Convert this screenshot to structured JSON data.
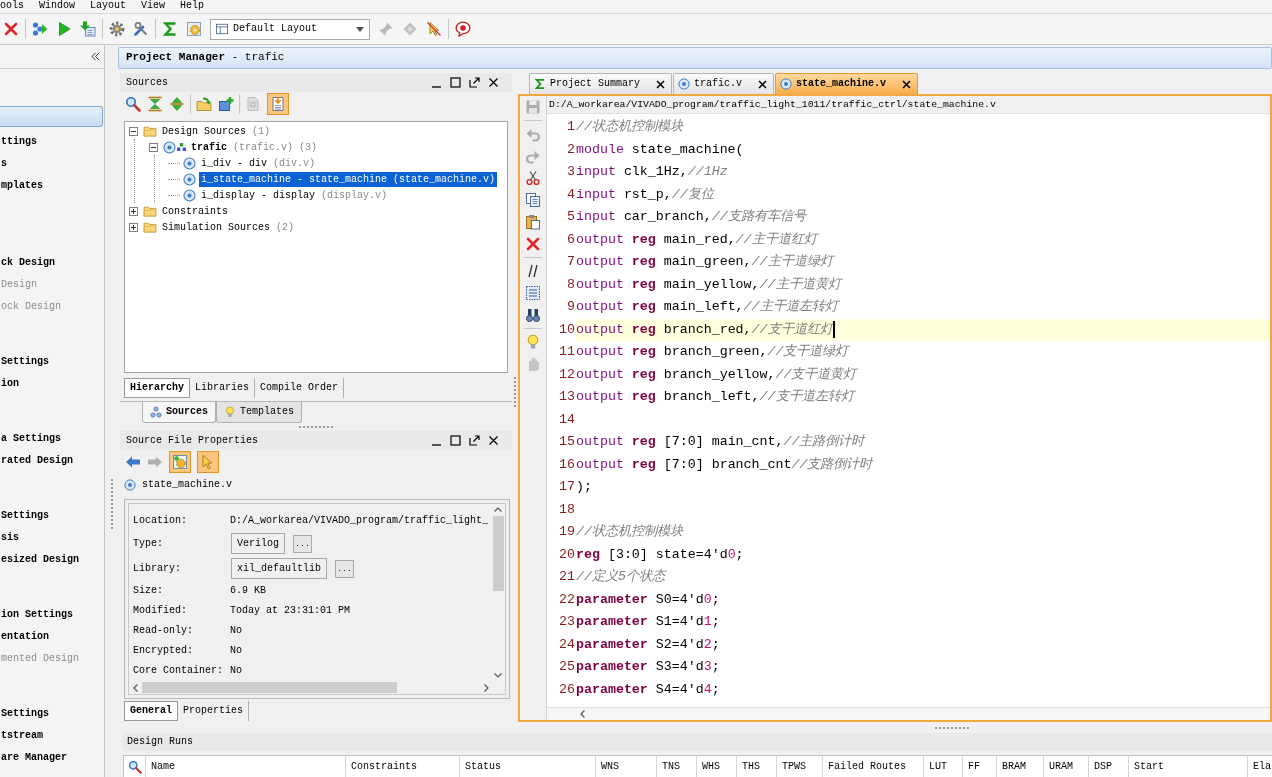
{
  "menu_bar": {
    "items": [
      "ools",
      "Window",
      "Layout",
      "View",
      "Help"
    ]
  },
  "toolbar": {
    "groups": [
      {
        "items": [
          {
            "kind": "cancel",
            "disabled": false
          }
        ]
      },
      {
        "items": [
          {
            "kind": "run",
            "disabled": false
          },
          {
            "kind": "play",
            "disabled": false
          },
          {
            "kind": "program",
            "disabled": false
          }
        ]
      },
      {
        "items": [
          {
            "kind": "settings",
            "disabled": false
          },
          {
            "kind": "tools",
            "disabled": false
          }
        ]
      },
      {
        "items": [
          {
            "kind": "sigma",
            "disabled": false
          },
          {
            "kind": "report",
            "disabled": false
          },
          {
            "kind": "layout_select",
            "value": "Default Layout",
            "disabled": false
          },
          {
            "kind": "pin",
            "disabled": true
          },
          {
            "kind": "diamond",
            "disabled": true
          },
          {
            "kind": "pointer",
            "disabled": false
          }
        ]
      },
      {
        "items": [
          {
            "kind": "bubble",
            "disabled": false
          }
        ]
      }
    ]
  },
  "flow_navigator": {
    "sections": [
      {
        "selected": true,
        "items": [
          {
            "label": "ttings",
            "disabled": false
          },
          {
            "label": "s",
            "disabled": false
          },
          {
            "label": "mplates",
            "disabled": false
          }
        ]
      },
      {
        "selected": false,
        "items": [
          {
            "label": "ck Design",
            "disabled": false
          },
          {
            "label": "Design",
            "disabled": true
          },
          {
            "label": "ock Design",
            "disabled": true
          }
        ]
      },
      {
        "selected": false,
        "items": [
          {
            "label": "Settings",
            "disabled": false
          },
          {
            "label": "ion",
            "disabled": false
          }
        ]
      },
      {
        "selected": false,
        "items": [
          {
            "label": "a Settings",
            "disabled": false
          },
          {
            "label": "rated Design",
            "disabled": false
          }
        ]
      },
      {
        "selected": false,
        "items": [
          {
            "label": "Settings",
            "disabled": false
          },
          {
            "label": "sis",
            "disabled": false
          },
          {
            "label": "esized Design",
            "disabled": false
          }
        ]
      },
      {
        "selected": false,
        "items": [
          {
            "label": "ion Settings",
            "disabled": false
          },
          {
            "label": "entation",
            "disabled": false
          },
          {
            "label": "mented Design",
            "disabled": true
          }
        ]
      },
      {
        "selected": false,
        "items": [
          {
            "label": "Settings",
            "disabled": false
          },
          {
            "label": "tstream",
            "disabled": false
          },
          {
            "label": "are Manager",
            "disabled": false
          }
        ]
      }
    ]
  },
  "project_manager": {
    "title": "**Project Manager** - trafic"
  },
  "sources_panel": {
    "title": "Sources",
    "toolbar": {
      "groups": [
        {
          "items": [
            {
              "kind": "search",
              "disabled": false,
              "on": false
            },
            {
              "kind": "collapse_all",
              "disabled": false,
              "on": false
            },
            {
              "kind": "expand_all",
              "disabled": false,
              "on": false
            }
          ]
        },
        {
          "items": [
            {
              "kind": "add_folder",
              "disabled": false,
              "on": false
            },
            {
              "kind": "add_sources",
              "disabled": false,
              "on": false
            }
          ]
        },
        {
          "items": [
            {
              "kind": "help_doc",
              "disabled": true,
              "on": false
            },
            {
              "kind": "autoupdate",
              "disabled": false,
              "on": true
            }
          ]
        }
      ]
    },
    "tree": [
      {
        "kind": "folder",
        "label": "Design Sources",
        "count": "(1)",
        "expanded": true,
        "selected": false,
        "children": [
          {
            "kind": "top",
            "label": "trafic",
            "file": "(trafic.v)",
            "count": "(3)",
            "expanded": true,
            "selected": false,
            "children": [
              {
                "kind": "module",
                "label": "i_div - div",
                "file": "(div.v)",
                "selected": false
              },
              {
                "kind": "module",
                "label": "i_state_machine - state_machine",
                "file": "(state_machine.v)",
                "selected": true
              },
              {
                "kind": "module",
                "label": "i_display - display",
                "file": "(display.v)",
                "selected": false
              }
            ]
          }
        ]
      },
      {
        "kind": "folder",
        "label": "Constraints",
        "expanded": false,
        "selected": false
      },
      {
        "kind": "folder",
        "label": "Simulation Sources",
        "count": "(2)",
        "expanded": false,
        "selected": false
      }
    ],
    "view_tabs": [
      {
        "label": "Hierarchy",
        "selected": true
      },
      {
        "label": "Libraries",
        "selected": false
      },
      {
        "label": "Compile Order",
        "selected": false
      }
    ],
    "bottom_tabs": [
      {
        "kind": "sources",
        "label": "Sources",
        "selected": true
      },
      {
        "kind": "templates",
        "label": "Templates",
        "selected": false
      }
    ]
  },
  "properties_panel": {
    "title": "Source File Properties",
    "toolbar": {
      "groups": [
        {
          "items": [
            {
              "kind": "back",
              "disabled": false,
              "on": false
            },
            {
              "kind": "forward",
              "disabled": true,
              "on": false
            },
            {
              "kind": "gear_doc",
              "disabled": false,
              "on": true
            },
            {
              "kind": "select_pointer",
              "disabled": false,
              "on": true
            }
          ]
        }
      ]
    },
    "file": "state_machine.v",
    "rows": [
      {
        "kind": "text",
        "label": "Location:",
        "value": "D:/A_workarea/VIVADO_program/traffic_light_"
      },
      {
        "kind": "field",
        "label": "Type:",
        "value": "Verilog",
        "button": "..."
      },
      {
        "kind": "field",
        "label": "Library:",
        "value": "xil_defaultlib",
        "button": "..."
      },
      {
        "kind": "text",
        "label": "Size:",
        "value": "6.9 KB"
      },
      {
        "kind": "text",
        "label": "Modified:",
        "value": "Today at 23:31:01 PM"
      },
      {
        "kind": "text",
        "label": "Read-only:",
        "value": "No"
      },
      {
        "kind": "text",
        "label": "Encrypted:",
        "value": "No"
      },
      {
        "kind": "text",
        "label": "Core Container:",
        "value": "No"
      }
    ],
    "tabs": [
      {
        "label": "General",
        "selected": true
      },
      {
        "label": "Properties",
        "selected": false
      }
    ]
  },
  "editor": {
    "tabs": [
      {
        "kind": "summary",
        "label": "Project Summary",
        "selected": false
      },
      {
        "kind": "verilog",
        "label": "trafic.v",
        "selected": false
      },
      {
        "kind": "verilog",
        "label": "state_machine.v",
        "selected": true
      }
    ],
    "path": "D:/A_workarea/VIVADO_program/traffic_light_1011/traffic_ctrl/state_machine.v",
    "gutter_toolbar": {
      "groups": [
        {
          "items": [
            {
              "kind": "save",
              "disabled": true
            }
          ]
        },
        {
          "items": [
            {
              "kind": "undo",
              "disabled": true
            },
            {
              "kind": "redo",
              "disabled": true
            },
            {
              "kind": "cut",
              "disabled": false
            },
            {
              "kind": "copy",
              "disabled": false
            },
            {
              "kind": "paste",
              "disabled": false
            },
            {
              "kind": "delete",
              "disabled": false
            }
          ]
        },
        {
          "items": [
            {
              "kind": "comment",
              "disabled": false
            },
            {
              "kind": "block",
              "disabled": false
            },
            {
              "kind": "find",
              "disabled": false
            }
          ]
        },
        {
          "items": [
            {
              "kind": "bulb",
              "disabled": false
            },
            {
              "kind": "hand",
              "disabled": true
            }
          ]
        }
      ]
    },
    "lines": [
      {
        "number": "1",
        "current": false,
        "tokens": [
          {
            "kind": "comment",
            "text": "//状态机控制模块"
          }
        ]
      },
      {
        "number": "2",
        "current": false,
        "tokens": [
          {
            "kind": "keyword",
            "text": "module"
          },
          {
            "kind": "plain",
            "text": " state_machine("
          }
        ]
      },
      {
        "number": "3",
        "current": false,
        "tokens": [
          {
            "kind": "keyword",
            "text": "input"
          },
          {
            "kind": "plain",
            "text": " clk_1Hz,"
          },
          {
            "kind": "comment",
            "text": "//1Hz"
          }
        ]
      },
      {
        "number": "4",
        "current": false,
        "tokens": [
          {
            "kind": "keyword",
            "text": "input"
          },
          {
            "kind": "plain",
            "text": " rst_p,"
          },
          {
            "kind": "comment",
            "text": "//复位"
          }
        ]
      },
      {
        "number": "5",
        "current": false,
        "tokens": [
          {
            "kind": "keyword",
            "text": "input"
          },
          {
            "kind": "plain",
            "text": " car_branch,"
          },
          {
            "kind": "comment",
            "text": "//支路有车信号"
          }
        ]
      },
      {
        "number": "6",
        "current": false,
        "tokens": [
          {
            "kind": "keyword",
            "text": "output "
          },
          {
            "kind": "type",
            "text": "reg"
          },
          {
            "kind": "plain",
            "text": " main_red,"
          },
          {
            "kind": "comment",
            "text": "//主干道红灯"
          }
        ]
      },
      {
        "number": "7",
        "current": false,
        "tokens": [
          {
            "kind": "keyword",
            "text": "output "
          },
          {
            "kind": "type",
            "text": "reg"
          },
          {
            "kind": "plain",
            "text": " main_green,"
          },
          {
            "kind": "comment",
            "text": "//主干道绿灯"
          }
        ]
      },
      {
        "number": "8",
        "current": false,
        "tokens": [
          {
            "kind": "keyword",
            "text": "output "
          },
          {
            "kind": "type",
            "text": "reg"
          },
          {
            "kind": "plain",
            "text": " main_yellow,"
          },
          {
            "kind": "comment",
            "text": "//主干道黄灯"
          }
        ]
      },
      {
        "number": "9",
        "current": false,
        "tokens": [
          {
            "kind": "keyword",
            "text": "output "
          },
          {
            "kind": "type",
            "text": "reg"
          },
          {
            "kind": "plain",
            "text": " main_left,"
          },
          {
            "kind": "comment",
            "text": "//主干道左转灯"
          }
        ]
      },
      {
        "number": "10",
        "current": true,
        "tokens": [
          {
            "kind": "keyword",
            "text": "output "
          },
          {
            "kind": "type",
            "text": "reg"
          },
          {
            "kind": "plain",
            "text": " branch_red,"
          },
          {
            "kind": "comment",
            "text": "//支干道红灯"
          }
        ]
      },
      {
        "number": "11",
        "current": false,
        "tokens": [
          {
            "kind": "keyword",
            "text": "output "
          },
          {
            "kind": "type",
            "text": "reg"
          },
          {
            "kind": "plain",
            "text": " branch_green,"
          },
          {
            "kind": "comment",
            "text": "//支干道绿灯"
          }
        ]
      },
      {
        "number": "12",
        "current": false,
        "tokens": [
          {
            "kind": "keyword",
            "text": "output "
          },
          {
            "kind": "type",
            "text": "reg"
          },
          {
            "kind": "plain",
            "text": " branch_yellow,"
          },
          {
            "kind": "comment",
            "text": "//支干道黄灯"
          }
        ]
      },
      {
        "number": "13",
        "current": false,
        "tokens": [
          {
            "kind": "keyword",
            "text": "output "
          },
          {
            "kind": "type",
            "text": "reg"
          },
          {
            "kind": "plain",
            "text": " branch_left,"
          },
          {
            "kind": "comment",
            "text": "//支干道左转灯"
          }
        ]
      },
      {
        "number": "14",
        "current": false
      },
      {
        "number": "15",
        "current": false,
        "tokens": [
          {
            "kind": "keyword",
            "text": "output "
          },
          {
            "kind": "type",
            "text": "reg"
          },
          {
            "kind": "plain",
            "text": " [7:0] main_cnt,"
          },
          {
            "kind": "comment",
            "text": "//主路倒计时"
          }
        ]
      },
      {
        "number": "16",
        "current": false,
        "tokens": [
          {
            "kind": "keyword",
            "text": "output "
          },
          {
            "kind": "type",
            "text": "reg"
          },
          {
            "kind": "plain",
            "text": " [7:0] branch_cnt"
          },
          {
            "kind": "comment",
            "text": "//支路倒计时"
          }
        ]
      },
      {
        "number": "17",
        "current": false,
        "tokens": [
          {
            "kind": "plain",
            "text": ");"
          }
        ]
      },
      {
        "number": "18",
        "current": false
      },
      {
        "number": "19",
        "current": false,
        "tokens": [
          {
            "kind": "comment",
            "text": "//状态机控制模块"
          }
        ]
      },
      {
        "number": "20",
        "current": false,
        "tokens": [
          {
            "kind": "type",
            "text": "reg"
          },
          {
            "kind": "plain",
            "text": " [3:0] state=4'd"
          },
          {
            "kind": "number",
            "text": "0"
          },
          {
            "kind": "plain",
            "text": ";"
          }
        ]
      },
      {
        "number": "21",
        "current": false,
        "tokens": [
          {
            "kind": "comment",
            "text": "//定义5个状态"
          }
        ]
      },
      {
        "number": "22",
        "current": false,
        "tokens": [
          {
            "kind": "type",
            "text": "parameter"
          },
          {
            "kind": "plain",
            "text": " S0=4'd"
          },
          {
            "kind": "number",
            "text": "0"
          },
          {
            "kind": "plain",
            "text": ";"
          }
        ]
      },
      {
        "number": "23",
        "current": false,
        "tokens": [
          {
            "kind": "type",
            "text": "parameter"
          },
          {
            "kind": "plain",
            "text": " S1=4'd"
          },
          {
            "kind": "number",
            "text": "1"
          },
          {
            "kind": "plain",
            "text": ";"
          }
        ]
      },
      {
        "number": "24",
        "current": false,
        "tokens": [
          {
            "kind": "type",
            "text": "parameter"
          },
          {
            "kind": "plain",
            "text": " S2=4'd"
          },
          {
            "kind": "number",
            "text": "2"
          },
          {
            "kind": "plain",
            "text": ";"
          }
        ]
      },
      {
        "number": "25",
        "current": false,
        "tokens": [
          {
            "kind": "type",
            "text": "parameter"
          },
          {
            "kind": "plain",
            "text": " S3=4'd"
          },
          {
            "kind": "number",
            "text": "3"
          },
          {
            "kind": "plain",
            "text": ";"
          }
        ]
      },
      {
        "number": "26",
        "current": false,
        "tokens": [
          {
            "kind": "type",
            "text": "parameter"
          },
          {
            "kind": "plain",
            "text": " S4=4'd"
          },
          {
            "kind": "number",
            "text": "4"
          },
          {
            "kind": "plain",
            "text": ";"
          }
        ]
      }
    ]
  },
  "design_runs": {
    "title": "Design Runs",
    "columns": [
      "Name",
      "Constraints",
      "Status",
      "WNS",
      "TNS",
      "WHS",
      "THS",
      "TPWS",
      "Failed Routes",
      "LUT",
      "FF",
      "BRAM",
      "URAM",
      "DSP",
      "Start",
      "Ela"
    ]
  }
}
